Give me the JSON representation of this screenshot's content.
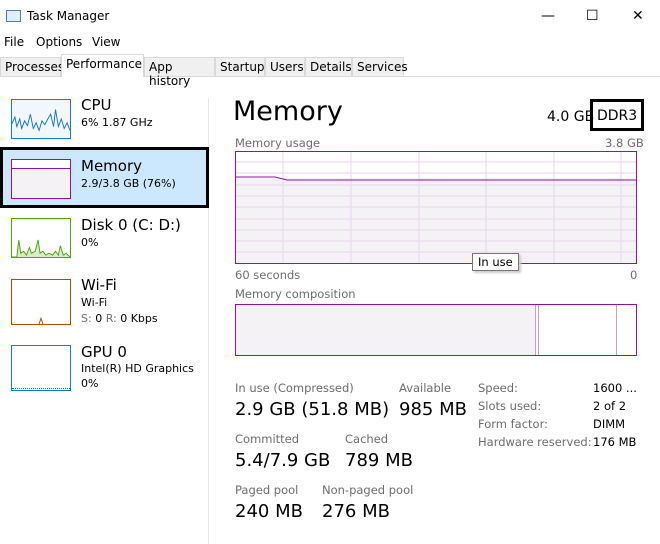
{
  "window": {
    "title": "Task Manager",
    "minimize": "—",
    "maximize": "☐",
    "close": "✕"
  },
  "menu": [
    "File",
    "Options",
    "View"
  ],
  "tabs": [
    "Processes",
    "Performance",
    "App history",
    "Startup",
    "Users",
    "Details",
    "Services"
  ],
  "sidebar": [
    {
      "title": "CPU",
      "sub": "6%  1.87 GHz",
      "color": "#1979ca"
    },
    {
      "title": "Memory",
      "sub": "2.9/3.8 GB (76%)",
      "color": "#8b12ae"
    },
    {
      "title": "Disk 0 (C: D:)",
      "sub": "0%",
      "color": "#4da60c"
    },
    {
      "title": "Wi-Fi",
      "sub": "Wi-Fi",
      "sub2_s": "S:",
      "sub2_sv": "0",
      "sub2_r": "R:",
      "sub2_rv": "0 Kbps",
      "color": "#a74f01"
    },
    {
      "title": "GPU 0",
      "sub": "Intel(R) HD Graphics",
      "sub2": "0%",
      "color": "#1979ca"
    }
  ],
  "main": {
    "title": "Memory",
    "capacity": "4.0 GB",
    "type": "DDR3",
    "usage_label": "Memory usage",
    "usage_max": "3.8 GB",
    "time_left": "60 seconds",
    "time_right": "0",
    "tooltip": "In use",
    "usage_fraction": 0.76,
    "composition_label": "Memory composition",
    "composition": {
      "in_use_fraction": 0.75,
      "modified_fraction": 0.005,
      "standby_fraction": 0.2
    },
    "stats": {
      "in_use_label": "In use (Compressed)",
      "in_use": "2.9 GB (51.8 MB)",
      "available_label": "Available",
      "available": "985 MB",
      "committed_label": "Committed",
      "committed": "5.4/7.9 GB",
      "cached_label": "Cached",
      "cached": "789 MB",
      "paged_label": "Paged pool",
      "paged": "240 MB",
      "nonpaged_label": "Non-paged pool",
      "nonpaged": "276 MB"
    },
    "details": [
      {
        "k": "Speed:",
        "v": "1600 ..."
      },
      {
        "k": "Slots used:",
        "v": "2 of 2"
      },
      {
        "k": "Form factor:",
        "v": "DIMM"
      },
      {
        "k": "Hardware reserved:",
        "v": "176 MB"
      }
    ]
  }
}
